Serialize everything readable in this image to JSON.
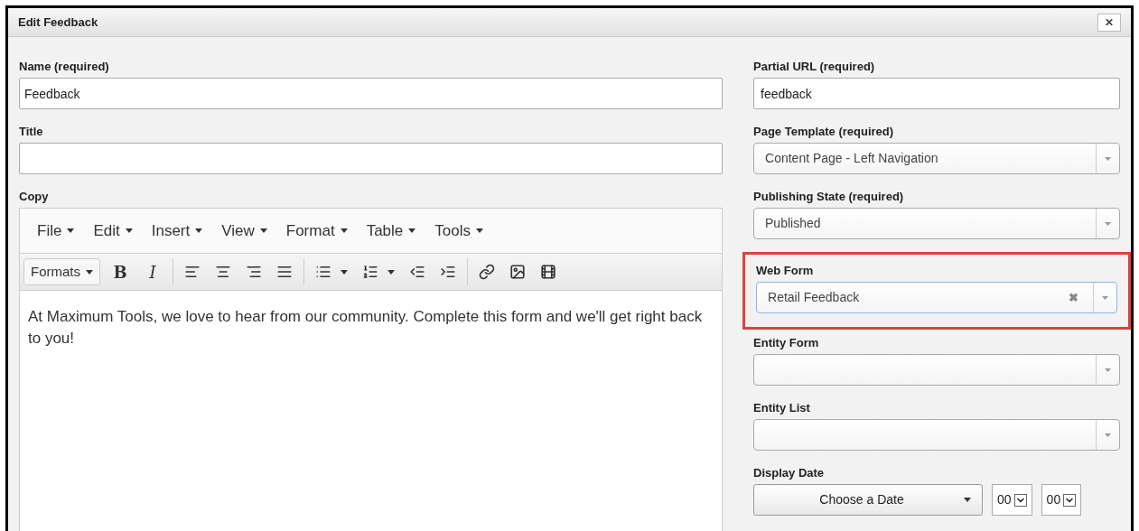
{
  "dialog": {
    "title": "Edit Feedback",
    "close": "✕"
  },
  "left": {
    "name": {
      "label": "Name (required)",
      "value": "Feedback"
    },
    "title": {
      "label": "Title"
    },
    "copy": {
      "label": "Copy",
      "menu": [
        "File",
        "Edit",
        "Insert",
        "View",
        "Format",
        "Table",
        "Tools"
      ],
      "toolbar": [
        {
          "kind": "dropdown",
          "text": "Formats"
        },
        {
          "kind": "bold",
          "text": "B"
        },
        {
          "kind": "italic",
          "text": "I"
        },
        {
          "kind": "sep"
        },
        {
          "kind": "alignleft"
        },
        {
          "kind": "aligncenter"
        },
        {
          "kind": "alignright"
        },
        {
          "kind": "justify"
        },
        {
          "kind": "sep"
        },
        {
          "kind": "bullets"
        },
        {
          "kind": "numbers"
        },
        {
          "kind": "outdent"
        },
        {
          "kind": "indent"
        },
        {
          "kind": "sep"
        },
        {
          "kind": "link"
        },
        {
          "kind": "image"
        },
        {
          "kind": "media"
        }
      ],
      "body": "At Maximum Tools, we love to hear from our community. Complete this form and we'll get right back to you!"
    }
  },
  "right": [
    {
      "kind": "text",
      "label": "Partial URL (required)",
      "value": "feedback"
    },
    {
      "kind": "select",
      "label": "Page Template (required)",
      "value": "Content Page - Left Navigation"
    },
    {
      "kind": "select",
      "label": "Publishing State (required)",
      "value": "Published"
    },
    {
      "kind": "select",
      "label": "Web Form",
      "value": "Retail Feedback",
      "clear": "✖",
      "highlighted": true
    },
    {
      "kind": "select",
      "label": "Entity Form"
    },
    {
      "kind": "select",
      "label": "Entity List"
    },
    {
      "kind": "date",
      "label": "Display Date",
      "button": "Choose a Date",
      "hour": "00",
      "minute": "00"
    }
  ]
}
